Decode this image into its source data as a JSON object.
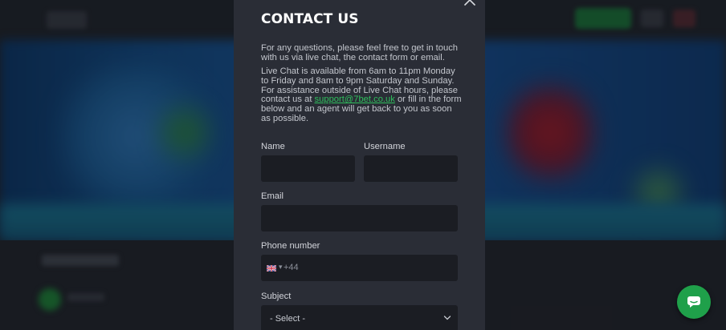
{
  "modal": {
    "title": "CONTACT US",
    "intro": "For any questions, please feel free to get in touch with us via live chat, the contact form or email.",
    "hours_before_link": "Live Chat is available from 6am to 11pm Monday to Friday and 8am to 9pm Saturday and Sunday. For assistance outside of Live Chat hours, please contact us at ",
    "support_email": "support@7bet.co.uk",
    "hours_after_link": " or fill in the form below and an agent will get back to you as soon as possible.",
    "close_icon": "close-icon"
  },
  "form": {
    "name_label": "Name",
    "name_value": "",
    "username_label": "Username",
    "username_value": "",
    "email_label": "Email",
    "email_value": "",
    "phone_label": "Phone number",
    "phone_country_icon": "uk-flag-icon",
    "phone_prefix": "+44",
    "subject_label": "Subject",
    "subject_selected": "- Select -"
  },
  "colors": {
    "accent": "#2fbf5d",
    "modal_bg": "#2a2d36",
    "field_bg": "#1b1d23",
    "chat_button": "#1fa04a"
  },
  "chat": {
    "icon": "chat-bubble-icon"
  }
}
